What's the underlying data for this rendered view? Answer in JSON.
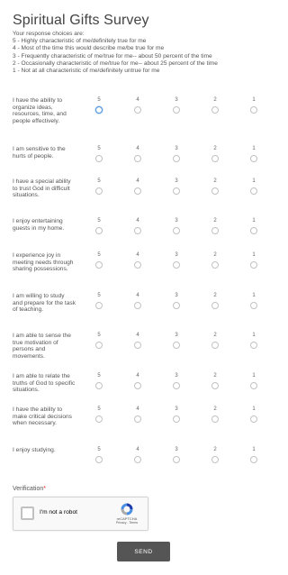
{
  "form": {
    "title": "Spiritual Gifts Survey",
    "instructions": [
      "Your response choices are:",
      "5 - Highly characteristic of me/definitely true for me",
      "4 - Most of the time this would describe me/be true for me",
      "3 - Frequently characteristic of me/true for me-- about 50 percent of the time",
      "2 - Occasionally characteristic of me/true for me-- about 25 percent of the time",
      "1 - Not at all characteristic of me/definitely untrue for me"
    ],
    "scale": [
      "5",
      "4",
      "3",
      "2",
      "1"
    ],
    "questions": [
      {
        "label": "I have the ability to organize ideas, resources, time, and people effectively."
      },
      {
        "label": "I am sensitive to the hurts of people."
      },
      {
        "label": "I have a special ability to trust God in difficult situations."
      },
      {
        "label": "I enjoy entertaining guests in my home."
      },
      {
        "label": "I experience joy in meeting needs through sharing possessions."
      },
      {
        "label": "I am willing to study and prepare for the task of teaching."
      },
      {
        "label": "I am able to sense the true motivation of persons and movements."
      },
      {
        "label": "I am able to relate the truths of God to specific situations."
      },
      {
        "label": "I have the ability to make critical decisions when necessary."
      },
      {
        "label": "I enjoy studying."
      }
    ]
  },
  "verification": {
    "label": "Verification",
    "required_mark": "*",
    "captcha_text": "I'm not a robot",
    "captcha_brand": "reCAPTCHA",
    "captcha_links": "Privacy - Terms"
  },
  "submit": {
    "label": "SEND"
  },
  "colors": {
    "focus_accent": "#4a90d9",
    "button_bg": "#555555",
    "required": "#e02424"
  }
}
